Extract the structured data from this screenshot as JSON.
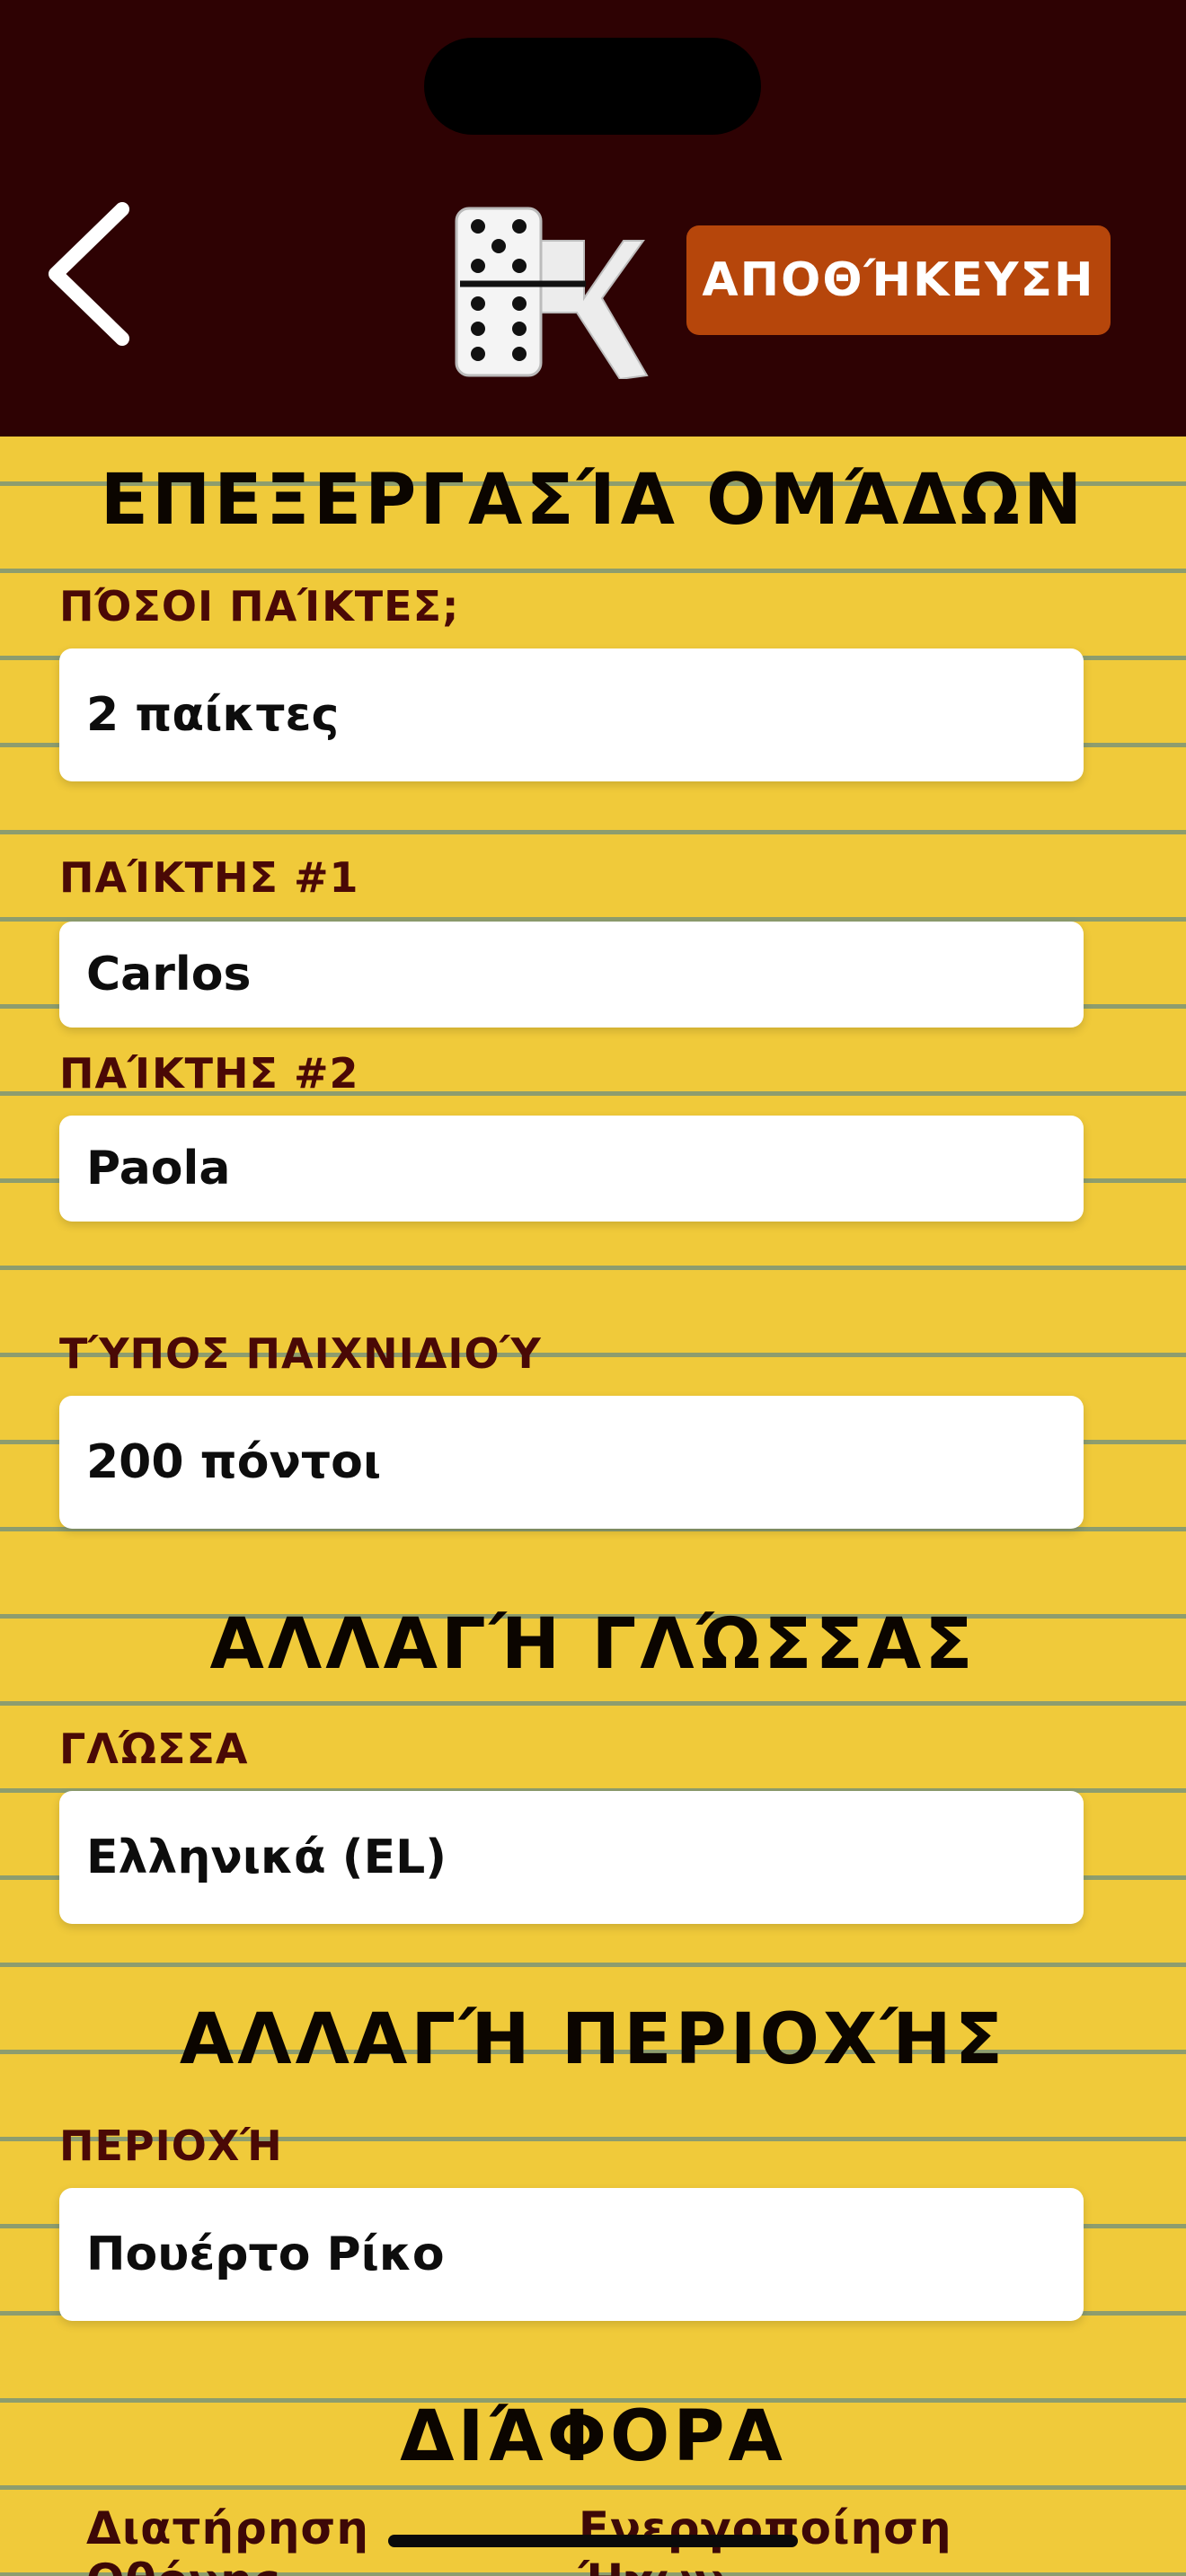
{
  "header": {
    "save_label": "ΑΠΟΘΉΚΕΥΣΗ",
    "logo_letter": "K"
  },
  "team_section": {
    "title": "ΕΠΕΞΕΡΓΑΣΊΑ ΟΜΆΔΩΝ",
    "players_count_label": "ΠΌΣΟΙ ΠΑΊΚΤΕΣ;",
    "players_count_value": "2 παίκτες",
    "player1_label": "ΠΑΊΚΤΗΣ #1",
    "player1_value": "Carlos",
    "player2_label": "ΠΑΊΚΤΗΣ #2",
    "player2_value": "Paola",
    "game_type_label": "ΤΎΠΟΣ ΠΑΙΧΝΙΔΙΟΎ",
    "game_type_value": "200 πόντοι"
  },
  "language_section": {
    "title": "ΑΛΛΑΓΉ ΓΛΏΣΣΑΣ",
    "language_label": "ΓΛΏΣΣΑ",
    "language_value": "Ελληνικά (EL)"
  },
  "region_section": {
    "title": "ΑΛΛΑΓΉ ΠΕΡΙΟΧΉΣ",
    "region_label": "ΠΕΡΙΟΧΉ",
    "region_value": "Πουέρτο Ρίκο"
  },
  "misc_section": {
    "title": "ΔΙΆΦΟΡΑ",
    "keep_screen_label": "Διατήρηση Οθόνης",
    "enable_sounds_label": "Ενεργοποίηση Ήχων"
  },
  "colors": {
    "header_bg": "#2e0203",
    "accent": "#b6460b",
    "paper": "#f0ca3a",
    "label": "#4a0906"
  }
}
